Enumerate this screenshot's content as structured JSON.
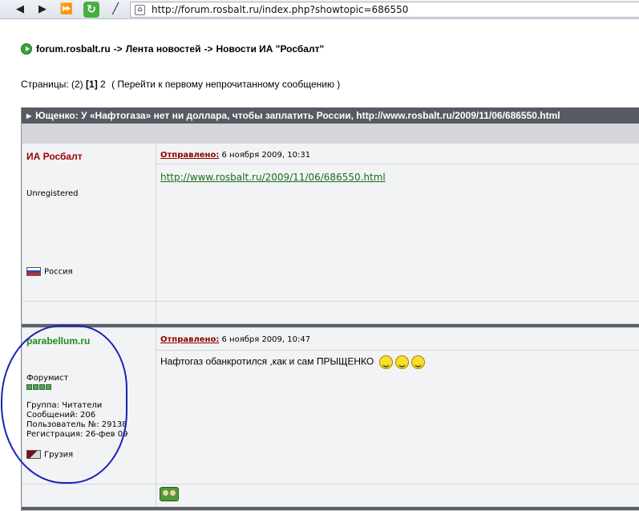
{
  "browser": {
    "url": "http://forum.rosbalt.ru/index.php?showtopic=686550"
  },
  "breadcrumb": {
    "items": [
      "forum.rosbalt.ru",
      "Лента новостей",
      "Новости ИА \"Росбалт\""
    ],
    "separator": "->"
  },
  "pages": {
    "label": "Страницы:",
    "count": "(2)",
    "current": "[1]",
    "next": "2",
    "unread_link": "( Перейти к первому непрочитанному сообщению )"
  },
  "topic": {
    "title": "Ющенко: У «Нафтогаза» нет ни доллара, чтобы заплатить России, http://www.rosbalt.ru/2009/11/06/686550.html"
  },
  "posts": [
    {
      "author": "ИА Росбалт",
      "author_color": "#990000",
      "posted_label": "Отправлено:",
      "posted_date": "6 ноября 2009, 10:31",
      "status": "Unregistered",
      "country": "Россия",
      "body_link": "http://www.rosbalt.ru/2009/11/06/686550.html"
    },
    {
      "author": "parabellum.ru",
      "author_color": "#1e8a1e",
      "posted_label": "Отправлено:",
      "posted_date": "6 ноября 2009, 10:47",
      "rank": "Форумист",
      "rank_pips": 4,
      "group": "Группа: Читатели",
      "messages": "Сообщений: 206",
      "user_no": "Пользователь №: 29138",
      "registered": "Регистрация: 26-фев 09",
      "country": "Грузия",
      "body_text": "Нафтогаз обанкротился ,как и сам ПРЫЩЕНКО"
    }
  ],
  "colors": {
    "title_bar": "#565b63",
    "annotation_circle": "#1a22b8",
    "link": "#1a6e1a"
  }
}
